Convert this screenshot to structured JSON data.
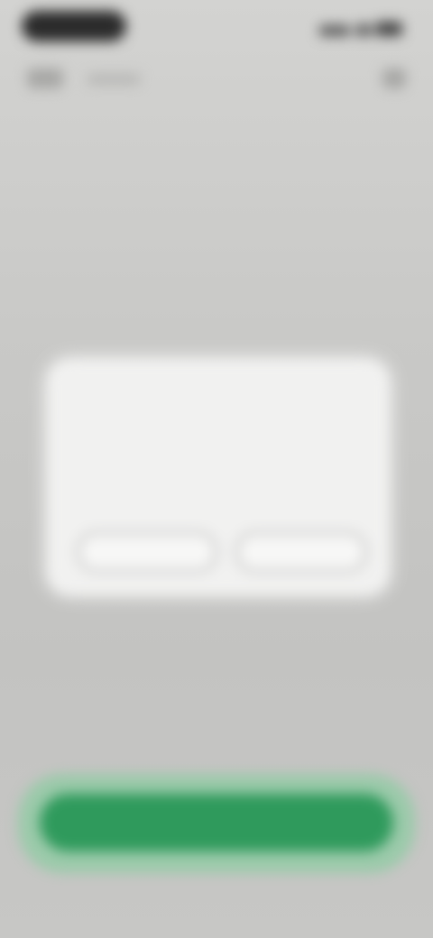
{
  "status_bar": {
    "time": ""
  },
  "dialog": {
    "title": "",
    "message": "",
    "left_button_label": "",
    "right_button_label": ""
  },
  "bottom": {
    "primary_button_label": "",
    "secondary_link_label": ""
  },
  "colors": {
    "accent_green": "#2f9a5c",
    "background": "#c6c6c4",
    "dialog_background": "#f1f1f0"
  },
  "icons": {
    "back": "back-arrow-icon",
    "menu": "more-icon",
    "signal": "signal-icon",
    "wifi": "wifi-icon",
    "battery": "battery-icon"
  }
}
